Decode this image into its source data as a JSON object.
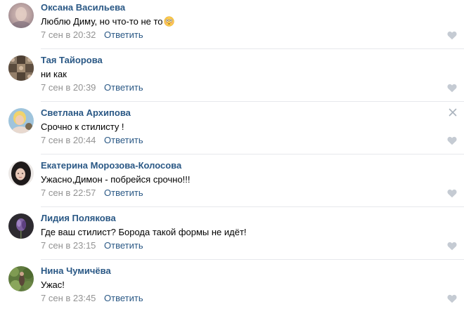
{
  "comments": [
    {
      "author": "Оксана Васильева",
      "text": "Люблю Диму, но что-то не то",
      "emoji": "flushed-face-icon",
      "date": "7 сен в 20:32",
      "reply": "Ответить",
      "avatar": "avatar-blurred-portrait"
    },
    {
      "author": "Тая Тайорова",
      "text": "ни как",
      "date": "7 сен в 20:39",
      "reply": "Ответить",
      "avatar": "avatar-photo-collage"
    },
    {
      "author": "Светлана Архипова",
      "text": "Срочно к стилисту !",
      "date": "7 сен в 20:44",
      "reply": "Ответить",
      "avatar": "avatar-blonde-woman"
    },
    {
      "author": "Екатерина Морозова-Колосова",
      "text": "Ужасно,Димон - побрейся срочно!!!",
      "date": "7 сен в 22:57",
      "reply": "Ответить",
      "avatar": "avatar-dark-hair-woman"
    },
    {
      "author": "Лидия Полякова",
      "text": "Где ваш стилист? Борода такой формы не идёт!",
      "date": "7 сен в 23:15",
      "reply": "Ответить",
      "avatar": "avatar-purple-flower"
    },
    {
      "author": "Нина Чумичёва",
      "text": "Ужас!",
      "date": "7 сен в 23:45",
      "reply": "Ответить",
      "avatar": "avatar-green-garden"
    }
  ],
  "colors": {
    "author": "#2a5885",
    "link": "#2a5885",
    "date": "#939393",
    "text": "#000000",
    "separator": "#e7e8ec",
    "icon": "#c5cbd3"
  },
  "icons": {
    "like": "heart-icon",
    "delete": "close-icon"
  }
}
